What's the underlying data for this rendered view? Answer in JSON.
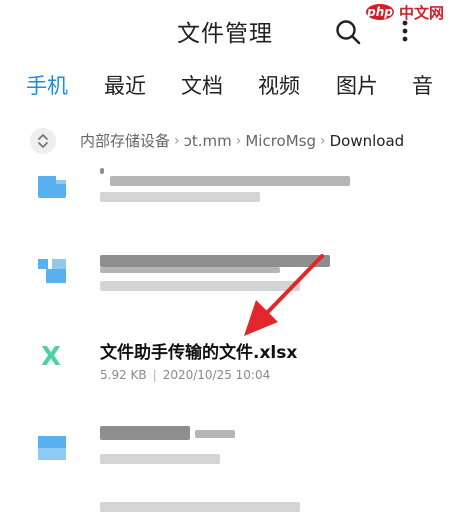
{
  "header": {
    "title": "文件管理",
    "watermark_logo": "php",
    "watermark_text": "中文网"
  },
  "tabs": [
    {
      "label": "手机",
      "active": true
    },
    {
      "label": "最近",
      "active": false
    },
    {
      "label": "文档",
      "active": false
    },
    {
      "label": "视频",
      "active": false
    },
    {
      "label": "图片",
      "active": false
    },
    {
      "label": "音",
      "active": false
    }
  ],
  "breadcrumb": {
    "items": [
      "内部存储设备",
      "ɔt.mm",
      "MicroMsg"
    ],
    "current": "Download"
  },
  "files": {
    "highlighted": {
      "name": "文件助手传输的文件.xlsx",
      "size": "5.92 KB",
      "date": "2020/10/25 10:04",
      "icon_letter": "X"
    }
  },
  "colors": {
    "accent": "#1f8ce0",
    "folder": "#5ab1ef",
    "excel": "#4cd3a2",
    "arrow": "#e4262b"
  }
}
